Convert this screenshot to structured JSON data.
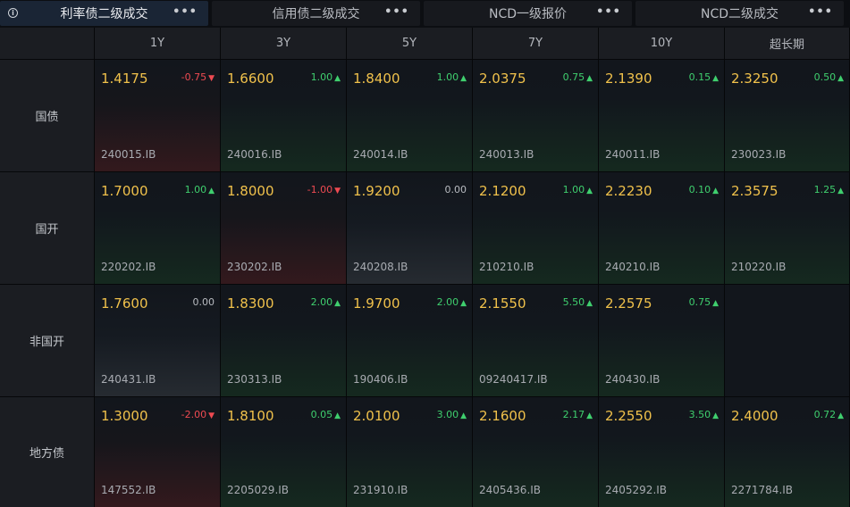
{
  "tabs": [
    {
      "label": "利率债二级成交",
      "active": true
    },
    {
      "label": "信用债二级成交",
      "active": false
    },
    {
      "label": "NCD一级报价",
      "active": false
    },
    {
      "label": "NCD二级成交",
      "active": false
    }
  ],
  "info_icon_glyph": "i",
  "more_glyph": "•••",
  "columns": [
    "1Y",
    "3Y",
    "5Y",
    "7Y",
    "10Y",
    "超长期"
  ],
  "rows": [
    {
      "label": "国债",
      "cells": [
        {
          "yield": "1.4175",
          "change": "-0.75",
          "dir": "down",
          "code": "240015.IB"
        },
        {
          "yield": "1.6600",
          "change": "1.00",
          "dir": "up",
          "code": "240016.IB"
        },
        {
          "yield": "1.8400",
          "change": "1.00",
          "dir": "up",
          "code": "240014.IB"
        },
        {
          "yield": "2.0375",
          "change": "0.75",
          "dir": "up",
          "code": "240013.IB"
        },
        {
          "yield": "2.1390",
          "change": "0.15",
          "dir": "up",
          "code": "240011.IB"
        },
        {
          "yield": "2.3250",
          "change": "0.50",
          "dir": "up",
          "code": "230023.IB"
        }
      ]
    },
    {
      "label": "国开",
      "cells": [
        {
          "yield": "1.7000",
          "change": "1.00",
          "dir": "up",
          "code": "220202.IB"
        },
        {
          "yield": "1.8000",
          "change": "-1.00",
          "dir": "down",
          "code": "230202.IB"
        },
        {
          "yield": "1.9200",
          "change": "0.00",
          "dir": null,
          "code": "240208.IB"
        },
        {
          "yield": "2.1200",
          "change": "1.00",
          "dir": "up",
          "code": "210210.IB"
        },
        {
          "yield": "2.2230",
          "change": "0.10",
          "dir": "up",
          "code": "240210.IB"
        },
        {
          "yield": "2.3575",
          "change": "1.25",
          "dir": "up",
          "code": "210220.IB"
        }
      ]
    },
    {
      "label": "非国开",
      "cells": [
        {
          "yield": "1.7600",
          "change": "0.00",
          "dir": null,
          "code": "240431.IB"
        },
        {
          "yield": "1.8300",
          "change": "2.00",
          "dir": "up",
          "code": "230313.IB"
        },
        {
          "yield": "1.9700",
          "change": "2.00",
          "dir": "up",
          "code": "190406.IB"
        },
        {
          "yield": "2.1550",
          "change": "5.50",
          "dir": "up",
          "code": "09240417.IB"
        },
        {
          "yield": "2.2575",
          "change": "0.75",
          "dir": "up",
          "code": "240430.IB"
        },
        null
      ]
    },
    {
      "label": "地方债",
      "cells": [
        {
          "yield": "1.3000",
          "change": "-2.00",
          "dir": "down",
          "code": "147552.IB"
        },
        {
          "yield": "1.8100",
          "change": "0.05",
          "dir": "up",
          "code": "2205029.IB"
        },
        {
          "yield": "2.0100",
          "change": "3.00",
          "dir": "up",
          "code": "231910.IB"
        },
        {
          "yield": "2.1600",
          "change": "2.17",
          "dir": "up",
          "code": "2405436.IB"
        },
        {
          "yield": "2.2550",
          "change": "3.50",
          "dir": "up",
          "code": "2405292.IB"
        },
        {
          "yield": "2.4000",
          "change": "0.72",
          "dir": "up",
          "code": "2271784.IB"
        }
      ]
    }
  ],
  "arrow_up": "▲",
  "arrow_down": "▼",
  "colors": {
    "up": "#3fcf6e",
    "down": "#ee4a52",
    "yield": "#f0c14b"
  }
}
